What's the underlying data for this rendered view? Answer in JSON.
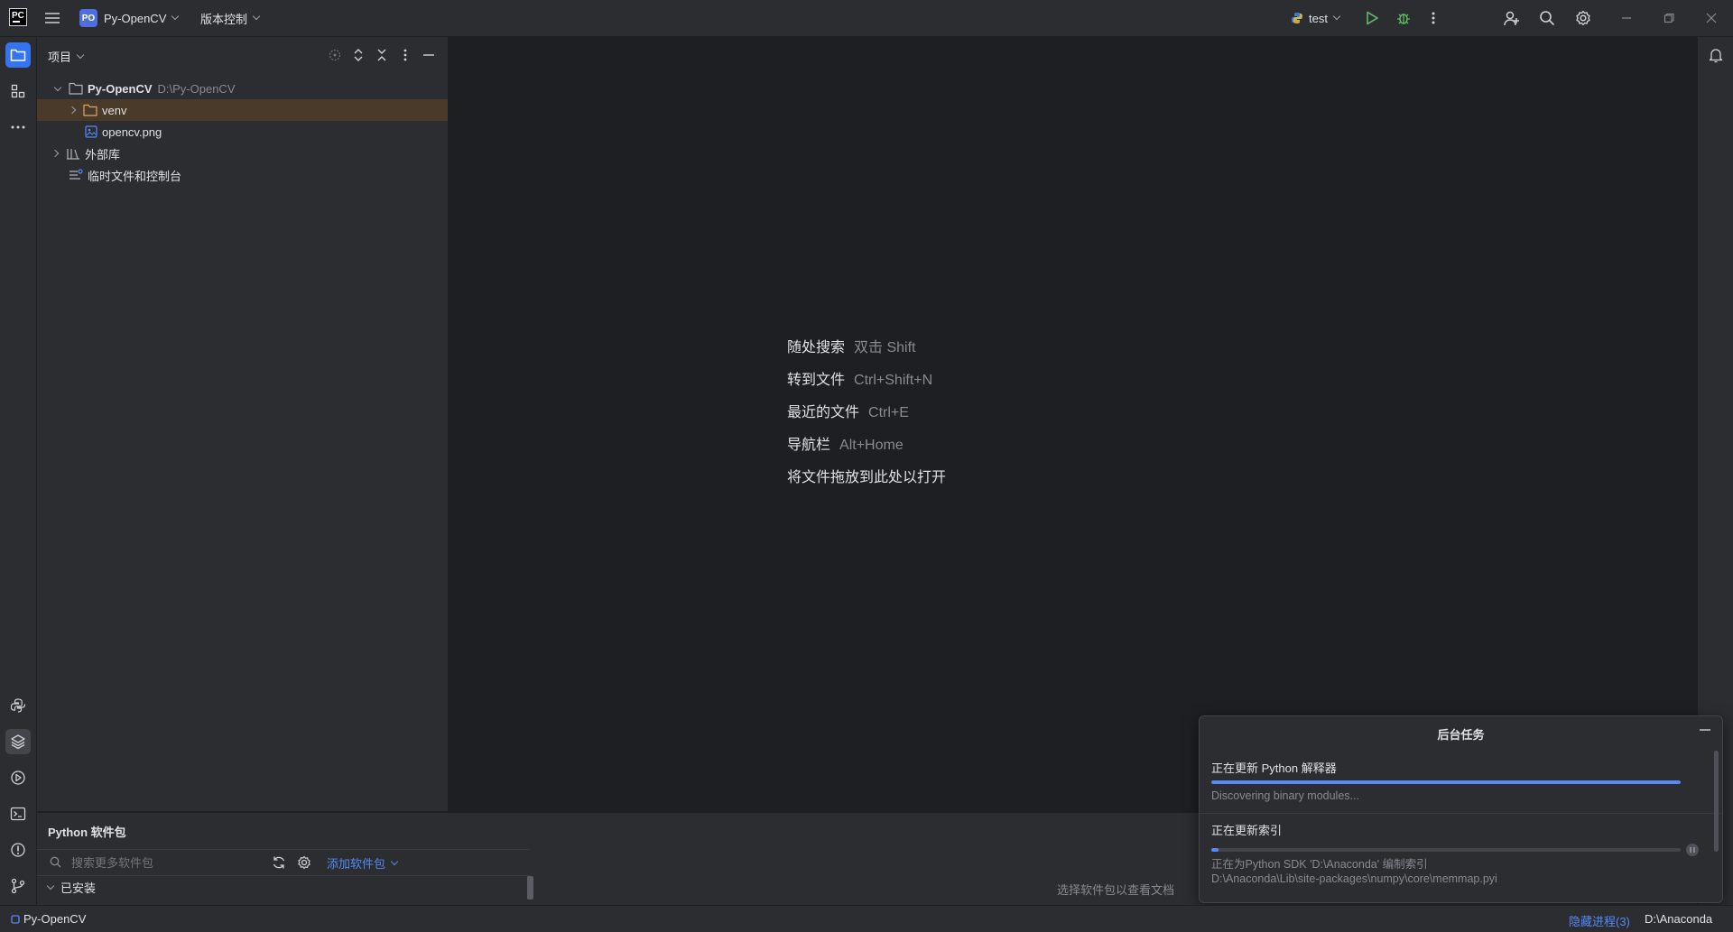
{
  "titlebar": {
    "logo_text": "PC",
    "project_badge": "PO",
    "project_name": "Py-OpenCV",
    "vcs_label": "版本控制",
    "run_config": "test"
  },
  "project_panel": {
    "title": "项目",
    "tree": [
      {
        "name": "Py-OpenCV",
        "path": "D:\\Py-OpenCV"
      },
      {
        "name": "venv"
      },
      {
        "name": "opencv.png"
      },
      {
        "name": "外部库"
      },
      {
        "name": "临时文件和控制台"
      }
    ]
  },
  "editor_hints": [
    {
      "label": "随处搜索",
      "shortcut": "双击 Shift"
    },
    {
      "label": "转到文件",
      "shortcut": "Ctrl+Shift+N"
    },
    {
      "label": "最近的文件",
      "shortcut": "Ctrl+E"
    },
    {
      "label": "导航栏",
      "shortcut": "Alt+Home"
    },
    {
      "label": "将文件拖放到此处以打开",
      "shortcut": ""
    }
  ],
  "python_packages": {
    "title": "Python 软件包",
    "search_placeholder": "搜索更多软件包",
    "add_package": "添加软件包",
    "installed": "已安装",
    "doc_hint": "选择软件包以查看文档"
  },
  "background_tasks": {
    "title": "后台任务",
    "tasks": [
      {
        "label": "正在更新 Python 解释器",
        "detail": "Discovering binary modules...",
        "progress": 1.0
      },
      {
        "label": "正在更新索引",
        "detail": "正在为Python SDK 'D:\\Anaconda' 编制索引",
        "detail2": "D:\\Anaconda\\Lib\\site-packages\\numpy\\core\\memmap.pyi",
        "progress": 0.015
      }
    ]
  },
  "statusbar": {
    "project": "Py-OpenCV",
    "hidden_processes": "隐藏进程(3)",
    "interpreter": "D:\\Anaconda"
  },
  "colors": {
    "accent": "#3574f0",
    "progress": "#548af7",
    "highlight_row": "#4a3a29",
    "run_green": "#5fb865"
  }
}
